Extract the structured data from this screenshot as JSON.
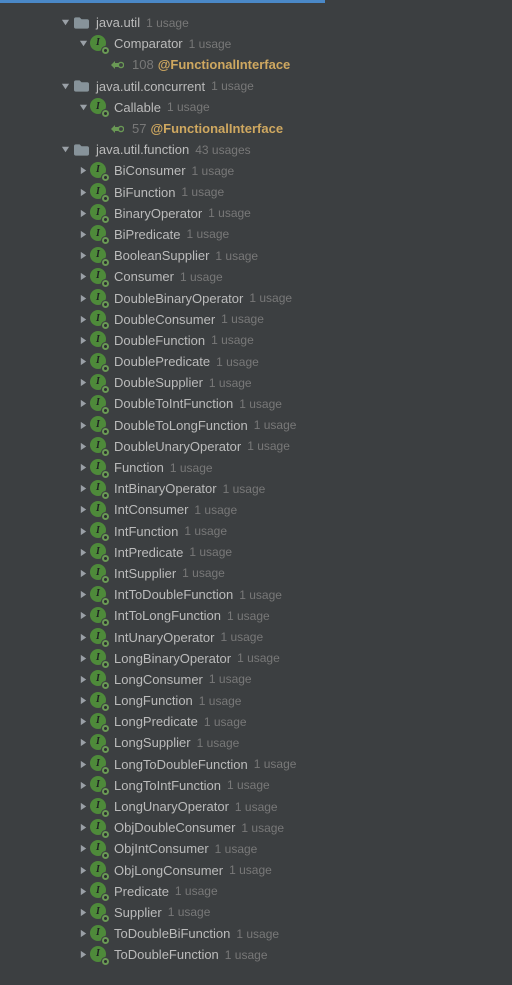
{
  "tree": [
    {
      "depth": 3,
      "expanded": true,
      "kind": "folder",
      "label": "java.util",
      "usages": "1 usage"
    },
    {
      "depth": 4,
      "expanded": true,
      "kind": "interface",
      "label": "Comparator",
      "usages": "1 usage"
    },
    {
      "depth": 5,
      "expanded": null,
      "kind": "impl",
      "line": "108",
      "anno": "@FunctionalInterface"
    },
    {
      "depth": 3,
      "expanded": true,
      "kind": "folder",
      "label": "java.util.concurrent",
      "usages": "1 usage"
    },
    {
      "depth": 4,
      "expanded": true,
      "kind": "interface",
      "label": "Callable",
      "usages": "1 usage"
    },
    {
      "depth": 5,
      "expanded": null,
      "kind": "impl",
      "line": "57",
      "anno": "@FunctionalInterface"
    },
    {
      "depth": 3,
      "expanded": true,
      "kind": "folder",
      "label": "java.util.function",
      "usages": "43 usages"
    },
    {
      "depth": 4,
      "expanded": false,
      "kind": "interface",
      "label": "BiConsumer",
      "usages": "1 usage"
    },
    {
      "depth": 4,
      "expanded": false,
      "kind": "interface",
      "label": "BiFunction",
      "usages": "1 usage"
    },
    {
      "depth": 4,
      "expanded": false,
      "kind": "interface",
      "label": "BinaryOperator",
      "usages": "1 usage"
    },
    {
      "depth": 4,
      "expanded": false,
      "kind": "interface",
      "label": "BiPredicate",
      "usages": "1 usage"
    },
    {
      "depth": 4,
      "expanded": false,
      "kind": "interface",
      "label": "BooleanSupplier",
      "usages": "1 usage"
    },
    {
      "depth": 4,
      "expanded": false,
      "kind": "interface",
      "label": "Consumer",
      "usages": "1 usage"
    },
    {
      "depth": 4,
      "expanded": false,
      "kind": "interface",
      "label": "DoubleBinaryOperator",
      "usages": "1 usage"
    },
    {
      "depth": 4,
      "expanded": false,
      "kind": "interface",
      "label": "DoubleConsumer",
      "usages": "1 usage"
    },
    {
      "depth": 4,
      "expanded": false,
      "kind": "interface",
      "label": "DoubleFunction",
      "usages": "1 usage"
    },
    {
      "depth": 4,
      "expanded": false,
      "kind": "interface",
      "label": "DoublePredicate",
      "usages": "1 usage"
    },
    {
      "depth": 4,
      "expanded": false,
      "kind": "interface",
      "label": "DoubleSupplier",
      "usages": "1 usage"
    },
    {
      "depth": 4,
      "expanded": false,
      "kind": "interface",
      "label": "DoubleToIntFunction",
      "usages": "1 usage"
    },
    {
      "depth": 4,
      "expanded": false,
      "kind": "interface",
      "label": "DoubleToLongFunction",
      "usages": "1 usage"
    },
    {
      "depth": 4,
      "expanded": false,
      "kind": "interface",
      "label": "DoubleUnaryOperator",
      "usages": "1 usage"
    },
    {
      "depth": 4,
      "expanded": false,
      "kind": "interface",
      "label": "Function",
      "usages": "1 usage"
    },
    {
      "depth": 4,
      "expanded": false,
      "kind": "interface",
      "label": "IntBinaryOperator",
      "usages": "1 usage"
    },
    {
      "depth": 4,
      "expanded": false,
      "kind": "interface",
      "label": "IntConsumer",
      "usages": "1 usage"
    },
    {
      "depth": 4,
      "expanded": false,
      "kind": "interface",
      "label": "IntFunction",
      "usages": "1 usage"
    },
    {
      "depth": 4,
      "expanded": false,
      "kind": "interface",
      "label": "IntPredicate",
      "usages": "1 usage"
    },
    {
      "depth": 4,
      "expanded": false,
      "kind": "interface",
      "label": "IntSupplier",
      "usages": "1 usage"
    },
    {
      "depth": 4,
      "expanded": false,
      "kind": "interface",
      "label": "IntToDoubleFunction",
      "usages": "1 usage"
    },
    {
      "depth": 4,
      "expanded": false,
      "kind": "interface",
      "label": "IntToLongFunction",
      "usages": "1 usage"
    },
    {
      "depth": 4,
      "expanded": false,
      "kind": "interface",
      "label": "IntUnaryOperator",
      "usages": "1 usage"
    },
    {
      "depth": 4,
      "expanded": false,
      "kind": "interface",
      "label": "LongBinaryOperator",
      "usages": "1 usage"
    },
    {
      "depth": 4,
      "expanded": false,
      "kind": "interface",
      "label": "LongConsumer",
      "usages": "1 usage"
    },
    {
      "depth": 4,
      "expanded": false,
      "kind": "interface",
      "label": "LongFunction",
      "usages": "1 usage"
    },
    {
      "depth": 4,
      "expanded": false,
      "kind": "interface",
      "label": "LongPredicate",
      "usages": "1 usage"
    },
    {
      "depth": 4,
      "expanded": false,
      "kind": "interface",
      "label": "LongSupplier",
      "usages": "1 usage"
    },
    {
      "depth": 4,
      "expanded": false,
      "kind": "interface",
      "label": "LongToDoubleFunction",
      "usages": "1 usage"
    },
    {
      "depth": 4,
      "expanded": false,
      "kind": "interface",
      "label": "LongToIntFunction",
      "usages": "1 usage"
    },
    {
      "depth": 4,
      "expanded": false,
      "kind": "interface",
      "label": "LongUnaryOperator",
      "usages": "1 usage"
    },
    {
      "depth": 4,
      "expanded": false,
      "kind": "interface",
      "label": "ObjDoubleConsumer",
      "usages": "1 usage"
    },
    {
      "depth": 4,
      "expanded": false,
      "kind": "interface",
      "label": "ObjIntConsumer",
      "usages": "1 usage"
    },
    {
      "depth": 4,
      "expanded": false,
      "kind": "interface",
      "label": "ObjLongConsumer",
      "usages": "1 usage"
    },
    {
      "depth": 4,
      "expanded": false,
      "kind": "interface",
      "label": "Predicate",
      "usages": "1 usage"
    },
    {
      "depth": 4,
      "expanded": false,
      "kind": "interface",
      "label": "Supplier",
      "usages": "1 usage"
    },
    {
      "depth": 4,
      "expanded": false,
      "kind": "interface",
      "label": "ToDoubleBiFunction",
      "usages": "1 usage"
    },
    {
      "depth": 4,
      "expanded": false,
      "kind": "interface",
      "label": "ToDoubleFunction",
      "usages": "1 usage"
    }
  ],
  "indentPx": 18,
  "baseIndent": 4
}
